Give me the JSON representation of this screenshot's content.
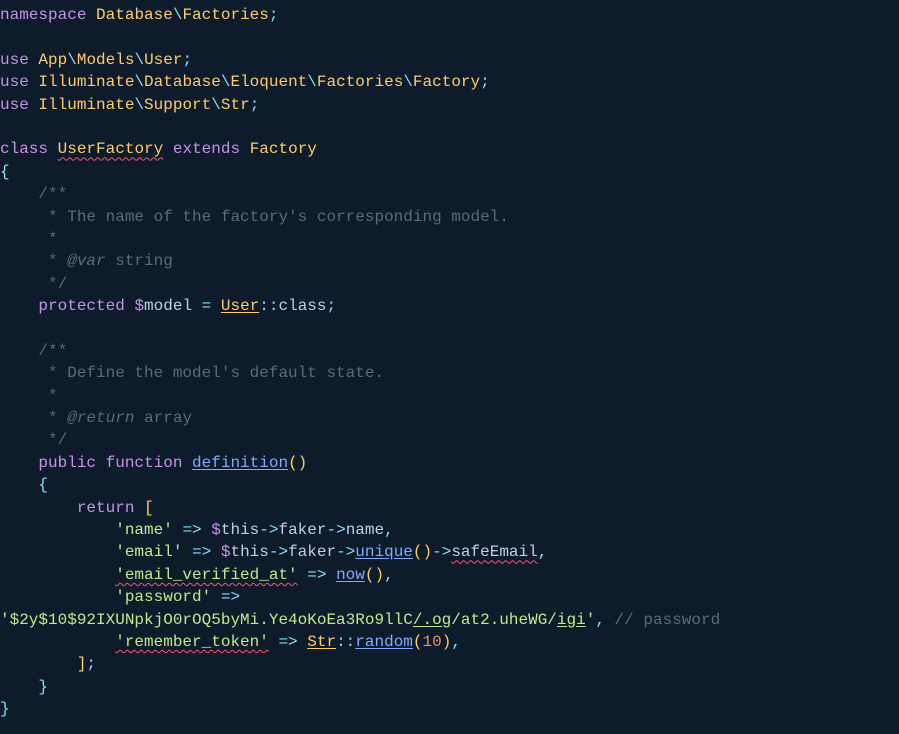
{
  "code": {
    "namespace_kw": "namespace",
    "namespace_path1": "Database",
    "namespace_path2": "Factories",
    "use_kw": "use",
    "use1_p1": "App",
    "use1_p2": "Models",
    "use1_p3": "User",
    "use2_p1": "Illuminate",
    "use2_p2": "Database",
    "use2_p3": "Eloquent",
    "use2_p4": "Factories",
    "use2_p5": "Factory",
    "use3_p1": "Illuminate",
    "use3_p2": "Support",
    "use3_p3": "Str",
    "class_kw": "class",
    "class_name": "UserFactory",
    "extends_kw": "extends",
    "extends_name": "Factory",
    "doc1_open": "/**",
    "doc1_l1": " * The name of the factory's corresponding model.",
    "doc1_l2": " *",
    "doc1_l3_prefix": " * ",
    "doc1_l3_tag": "@var",
    "doc1_l3_type": " string",
    "doc1_close": " */",
    "protected_kw": "protected",
    "model_var": "model",
    "user_cls": "User",
    "class_const": "class",
    "doc2_open": "/**",
    "doc2_l1": " * Define the model's default state.",
    "doc2_l2": " *",
    "doc2_l3_prefix": " * ",
    "doc2_l3_tag": "@return",
    "doc2_l3_type": " array",
    "doc2_close": " */",
    "public_kw": "public",
    "function_kw": "function",
    "method_name": "definition",
    "return_kw": "return",
    "key_name": "'name'",
    "this_var": "this",
    "faker_prop": "faker",
    "name_prop": "name",
    "key_email": "'email'",
    "unique_method": "unique",
    "safeEmail_prop": "safeEmail",
    "key_email_verified": "'email_verified_at'",
    "now_fn": "now",
    "key_password": "'password'",
    "password_str_p1": "'$2y$10$92IXUNpkjO0rOQ5byMi.Ye4oKoEa3Ro9llC",
    "password_str_p2": "/.og",
    "password_str_p3": "/at2.uheWG/",
    "password_str_p4": "igi",
    "password_str_p5": "'",
    "password_comment": "// password",
    "key_remember": "'remember_token'",
    "str_cls": "Str",
    "random_method": "random",
    "random_arg": "10"
  }
}
